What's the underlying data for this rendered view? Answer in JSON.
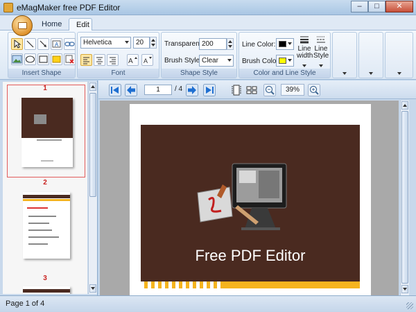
{
  "window": {
    "title": "eMagMaker free PDF Editor",
    "minimize": "–",
    "maximize": "□",
    "close": "✕"
  },
  "tabs": [
    {
      "label": "Home"
    },
    {
      "label": "Edit"
    }
  ],
  "ribbon": {
    "insert_shape": {
      "label": "Insert Shape"
    },
    "font": {
      "label": "Font",
      "family": "Helvetica",
      "size": "20"
    },
    "shape_style": {
      "label": "Shape Style",
      "transparent_label": "Transparent:",
      "transparent_value": "200",
      "brush_label": "Brush Style:",
      "brush_value": "Clear"
    },
    "color_line": {
      "label": "Color and Line Style",
      "line_color_label": "Line Color:",
      "brush_color_label": "Brush Color:",
      "line_width_label": "Line\nwidth",
      "line_style_label": "Line\nStyle",
      "line_color": "#000000",
      "brush_color": "#ffff00"
    }
  },
  "thumbnails": [
    {
      "number": "1",
      "selected": true
    },
    {
      "number": "2",
      "selected": false
    },
    {
      "number": "3",
      "selected": false
    }
  ],
  "navigation": {
    "current_page": "1",
    "total": "/ 4",
    "zoom": "39%"
  },
  "document": {
    "cover_title": "Free PDF Editor",
    "cover_color": "#4a2a20",
    "band_color": "#f6b41e"
  },
  "status": {
    "text": "Page 1 of 4"
  }
}
